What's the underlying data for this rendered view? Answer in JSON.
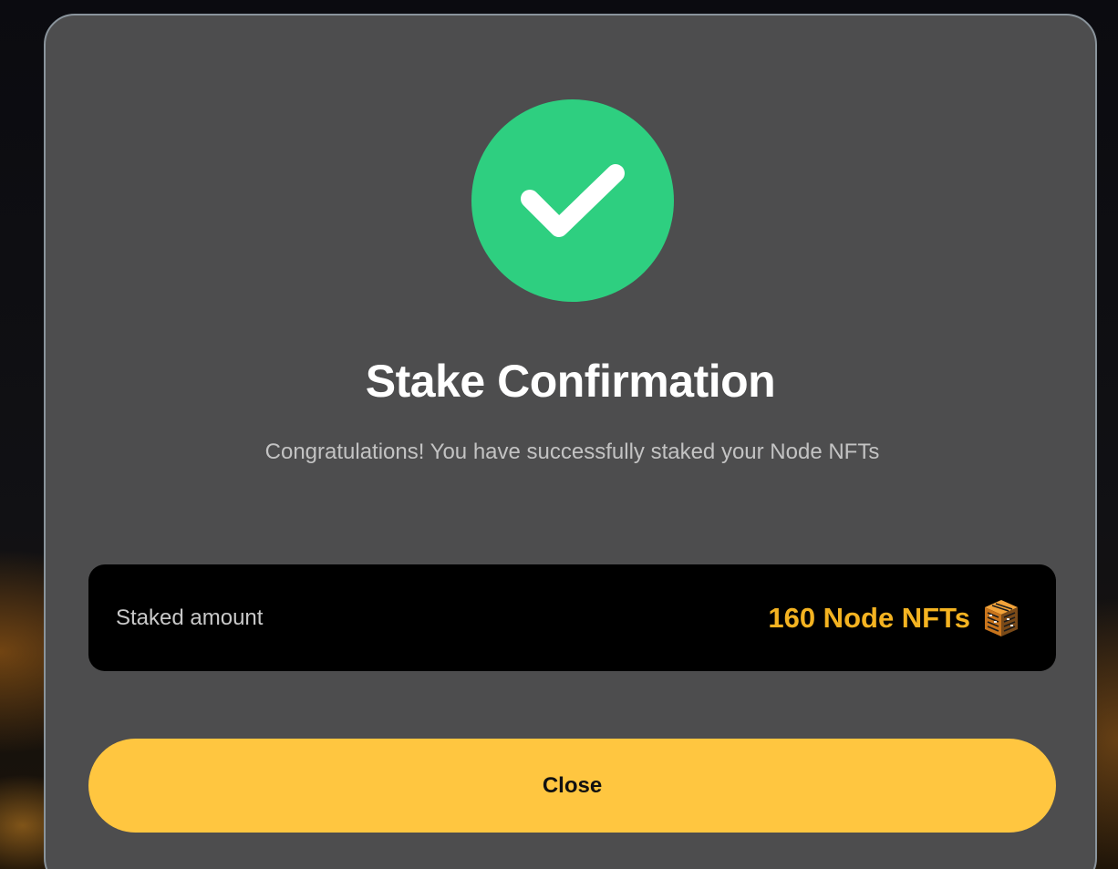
{
  "modal": {
    "icon": "check-circle-icon",
    "title": "Stake Confirmation",
    "message": "Congratulations! You have successfully staked your Node NFTs",
    "staked": {
      "label": "Staked amount",
      "value": "160 Node NFTs",
      "icon": "node-nft-icon"
    },
    "close_label": "Close"
  },
  "colors": {
    "success": "#2ecf80",
    "accent": "#ffc640",
    "amount_text": "#f4b321",
    "modal_bg": "#4d4d4e"
  }
}
